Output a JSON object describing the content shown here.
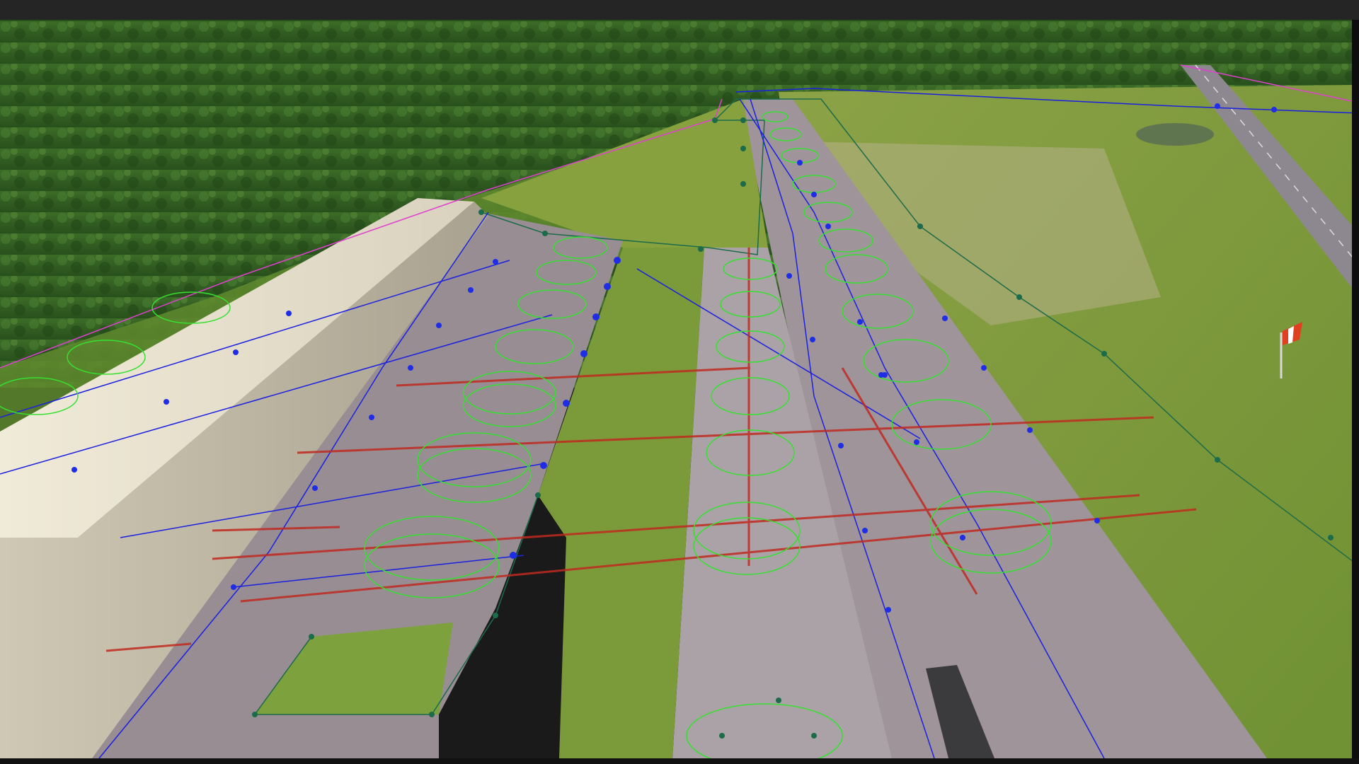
{
  "window": {
    "title": ""
  },
  "scene": {
    "description_key": "msfs-scenery-editor-viewport",
    "colors": {
      "forest": "#2f5a22",
      "grass": "#7e9a3c",
      "apron": "#9a8f95",
      "hangar": "#e6dfcf",
      "taxi_path": "#1a20e0",
      "taxi_node": "#1f2ee6",
      "parking_ring": "#36e030",
      "runway_line": "#c02a20",
      "boundary": "#1c6b4a",
      "fence": "#e040d0",
      "windsock": "#e04020"
    },
    "icons": [
      "windsock-icon"
    ]
  }
}
